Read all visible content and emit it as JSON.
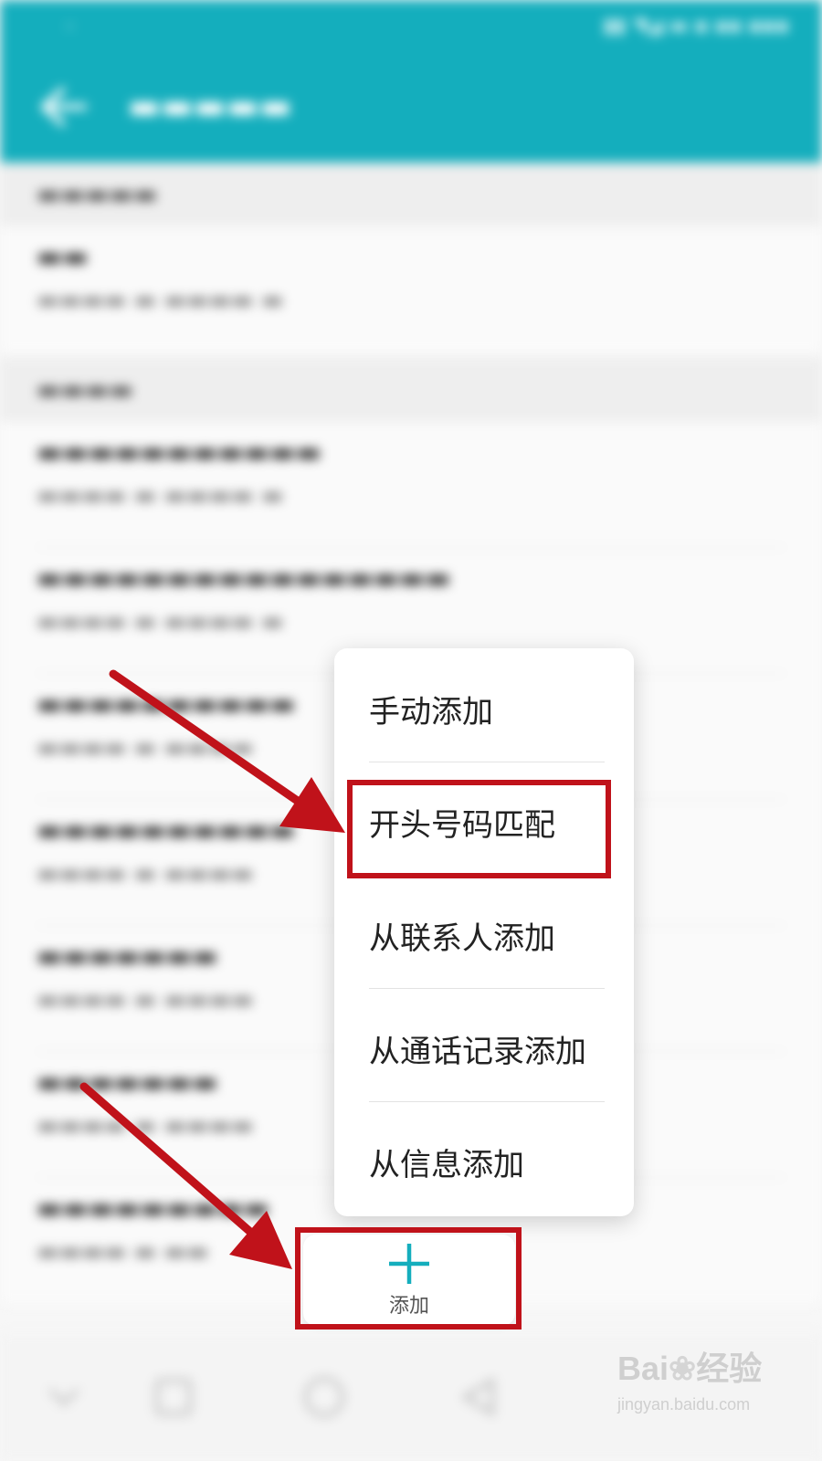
{
  "popup_menu": {
    "items": [
      {
        "label": "手动添加"
      },
      {
        "label": "开头号码匹配"
      },
      {
        "label": "从联系人添加"
      },
      {
        "label": "从通话记录添加"
      },
      {
        "label": "从信息添加"
      }
    ]
  },
  "add_button": {
    "label": "添加",
    "icon": "plus-icon",
    "accent_color": "#14aebd"
  },
  "annotation": {
    "color": "#c0121a"
  },
  "watermark": {
    "logo": "Bai",
    "logo_suffix": "经验",
    "url": "jingyan.baidu.com"
  },
  "colors": {
    "app_bar": "#14aebd"
  }
}
